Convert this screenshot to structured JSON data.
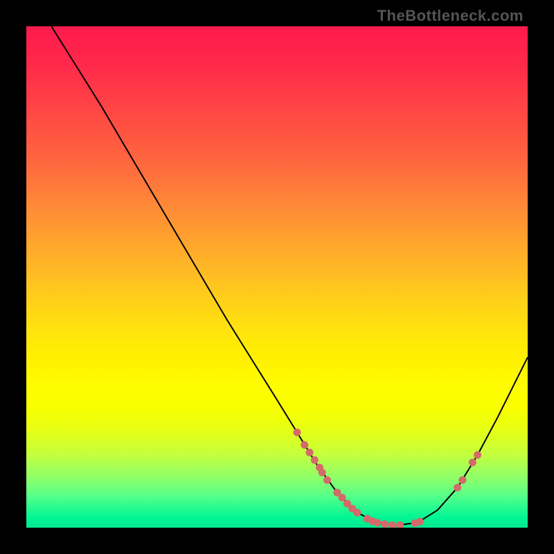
{
  "watermark": "TheBottleneck.com",
  "chart_data": {
    "type": "line",
    "title": "",
    "xlabel": "",
    "ylabel": "",
    "xlim": [
      0,
      100
    ],
    "ylim": [
      0,
      100
    ],
    "background_gradient": {
      "top": "#ff1a4d",
      "middle": "#fff000",
      "bottom": "#00e890"
    },
    "curve": [
      {
        "x": 5.0,
        "y": 100.0
      },
      {
        "x": 10.0,
        "y": 92.0
      },
      {
        "x": 15.0,
        "y": 84.0
      },
      {
        "x": 20.0,
        "y": 75.5
      },
      {
        "x": 25.0,
        "y": 67.0
      },
      {
        "x": 30.0,
        "y": 58.5
      },
      {
        "x": 35.0,
        "y": 50.0
      },
      {
        "x": 40.0,
        "y": 41.5
      },
      {
        "x": 45.0,
        "y": 33.5
      },
      {
        "x": 50.0,
        "y": 25.5
      },
      {
        "x": 54.0,
        "y": 19.0
      },
      {
        "x": 58.0,
        "y": 12.5
      },
      {
        "x": 62.0,
        "y": 7.0
      },
      {
        "x": 66.0,
        "y": 3.0
      },
      {
        "x": 70.0,
        "y": 1.0
      },
      {
        "x": 74.0,
        "y": 0.5
      },
      {
        "x": 78.0,
        "y": 1.0
      },
      {
        "x": 82.0,
        "y": 3.5
      },
      {
        "x": 86.0,
        "y": 8.0
      },
      {
        "x": 90.0,
        "y": 14.5
      },
      {
        "x": 94.0,
        "y": 22.0
      },
      {
        "x": 98.0,
        "y": 30.0
      },
      {
        "x": 100.0,
        "y": 34.0
      }
    ],
    "highlight_points": [
      {
        "x": 54.0,
        "y": 19.0
      },
      {
        "x": 55.5,
        "y": 16.5
      },
      {
        "x": 56.5,
        "y": 15.0
      },
      {
        "x": 57.5,
        "y": 13.5
      },
      {
        "x": 58.5,
        "y": 12.0
      },
      {
        "x": 59.0,
        "y": 11.0
      },
      {
        "x": 60.0,
        "y": 9.5
      },
      {
        "x": 62.0,
        "y": 7.0
      },
      {
        "x": 63.0,
        "y": 6.0
      },
      {
        "x": 64.0,
        "y": 4.8
      },
      {
        "x": 65.0,
        "y": 3.8
      },
      {
        "x": 66.0,
        "y": 3.0
      },
      {
        "x": 68.0,
        "y": 1.8
      },
      {
        "x": 69.0,
        "y": 1.3
      },
      {
        "x": 70.0,
        "y": 1.0
      },
      {
        "x": 71.5,
        "y": 0.7
      },
      {
        "x": 73.0,
        "y": 0.5
      },
      {
        "x": 74.5,
        "y": 0.5
      },
      {
        "x": 77.5,
        "y": 0.9
      },
      {
        "x": 78.5,
        "y": 1.2
      },
      {
        "x": 86.0,
        "y": 8.0
      },
      {
        "x": 87.0,
        "y": 9.5
      },
      {
        "x": 89.0,
        "y": 13.0
      },
      {
        "x": 90.0,
        "y": 14.5
      }
    ],
    "dot_color": "#d46a6a"
  }
}
